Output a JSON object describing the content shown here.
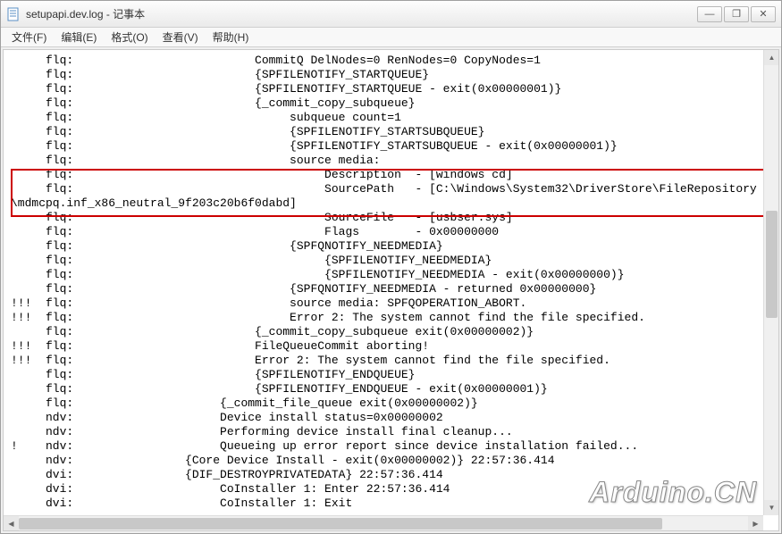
{
  "window": {
    "title": "setupapi.dev.log - 记事本",
    "controls": {
      "minimize": "—",
      "maximize": "❐",
      "close": "✕"
    }
  },
  "menu": {
    "file": "文件(F)",
    "edit": "编辑(E)",
    "format": "格式(O)",
    "view": "查看(V)",
    "help": "帮助(H)"
  },
  "log_lines": [
    "     flq:                          CommitQ DelNodes=0 RenNodes=0 CopyNodes=1",
    "     flq:                          {SPFILENOTIFY_STARTQUEUE}",
    "     flq:                          {SPFILENOTIFY_STARTQUEUE - exit(0x00000001)}",
    "     flq:                          {_commit_copy_subqueue}",
    "     flq:                               subqueue count=1",
    "     flq:                               {SPFILENOTIFY_STARTSUBQUEUE}",
    "     flq:                               {SPFILENOTIFY_STARTSUBQUEUE - exit(0x00000001)}",
    "     flq:                               source media:",
    "     flq:                                    Description  - [windows cd]",
    "     flq:                                    SourcePath   - [C:\\Windows\\System32\\DriverStore\\FileRepository",
    "\\mdmcpq.inf_x86_neutral_9f203c20b6f0dabd]",
    "     flq:                                    SourceFile   - [usbser.sys]",
    "     flq:                                    Flags        - 0x00000000",
    "     flq:                               {SPFQNOTIFY_NEEDMEDIA}",
    "     flq:                                    {SPFILENOTIFY_NEEDMEDIA}",
    "     flq:                                    {SPFILENOTIFY_NEEDMEDIA - exit(0x00000000)}",
    "     flq:                               {SPFQNOTIFY_NEEDMEDIA - returned 0x00000000}",
    "!!!  flq:                               source media: SPFQOPERATION_ABORT.",
    "!!!  flq:                               Error 2: The system cannot find the file specified.",
    "     flq:                          {_commit_copy_subqueue exit(0x00000002)}",
    "!!!  flq:                          FileQueueCommit aborting!",
    "!!!  flq:                          Error 2: The system cannot find the file specified.",
    "     flq:                          {SPFILENOTIFY_ENDQUEUE}",
    "     flq:                          {SPFILENOTIFY_ENDQUEUE - exit(0x00000001)}",
    "     flq:                     {_commit_file_queue exit(0x00000002)}",
    "     ndv:                     Device install status=0x00000002",
    "     ndv:                     Performing device install final cleanup...",
    "!    ndv:                     Queueing up error report since device installation failed...",
    "     ndv:                {Core Device Install - exit(0x00000002)} 22:57:36.414",
    "     dvi:                {DIF_DESTROYPRIVATEDATA} 22:57:36.414",
    "     dvi:                     CoInstaller 1: Enter 22:57:36.414",
    "     dvi:                     CoInstaller 1: Exit"
  ],
  "watermark": "Arduino.CN"
}
